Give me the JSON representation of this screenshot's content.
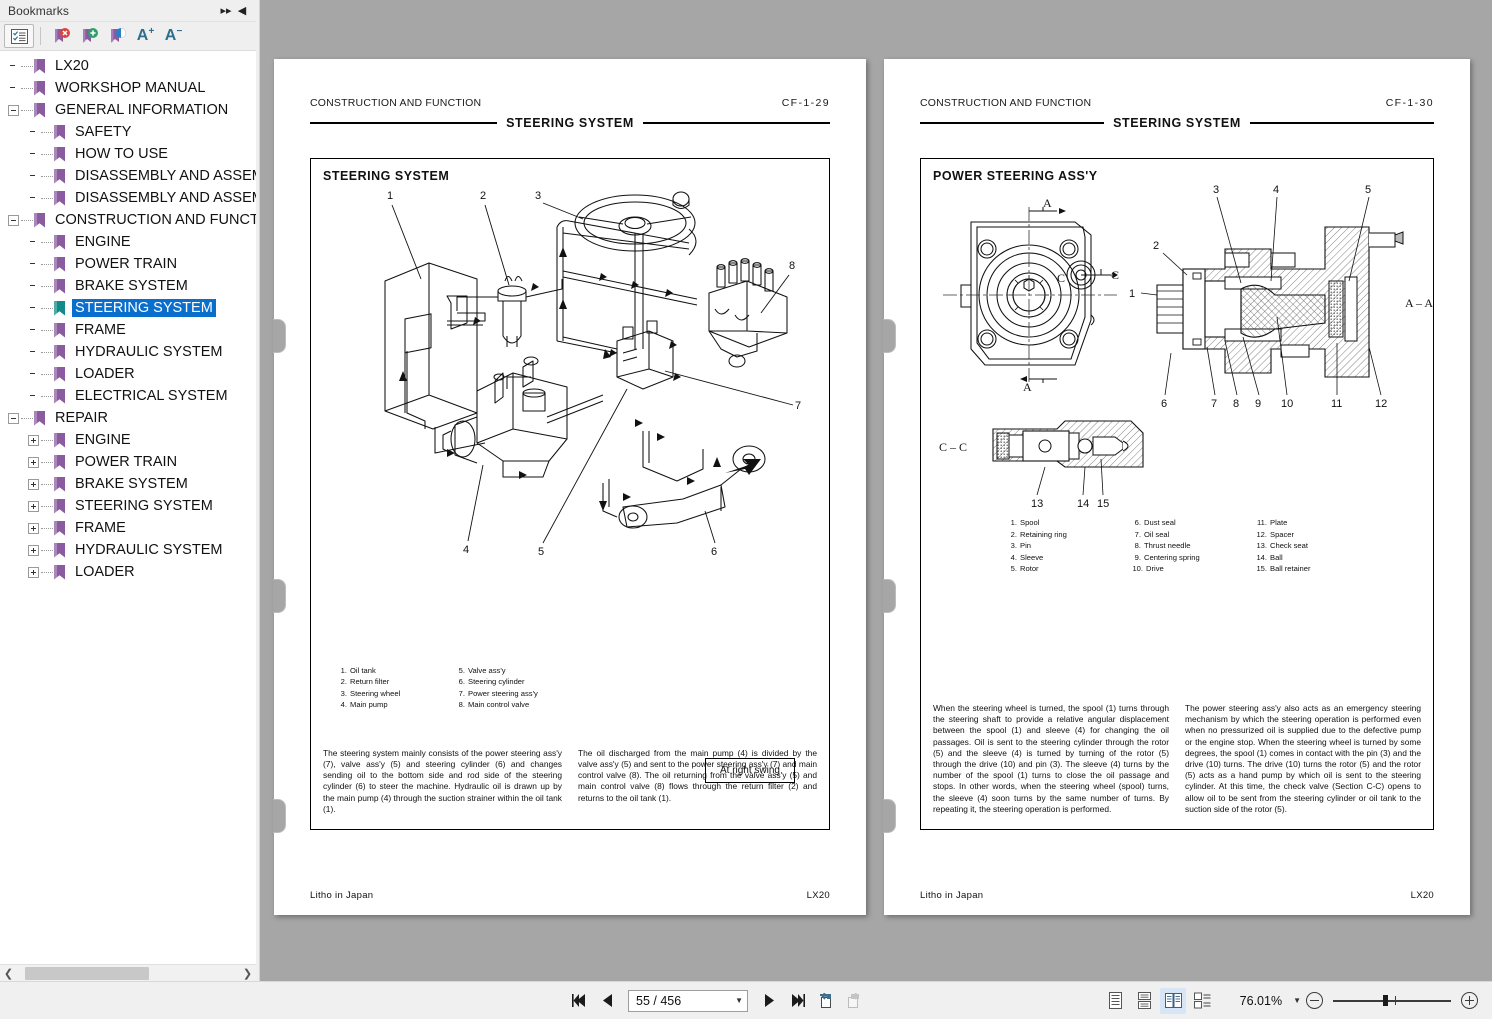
{
  "bookmarks_panel": {
    "title": "Bookmarks",
    "collapse_all_icon": "chevron-double-right-icon",
    "hide_panel_icon": "triangle-left-icon",
    "toolbar": [
      {
        "name": "bookmark-options-icon",
        "glyph": "list-check"
      },
      {
        "name": "delete-bookmark-icon",
        "glyph": "bookmark-x"
      },
      {
        "name": "new-bookmark-icon",
        "glyph": "bookmark-plus"
      },
      {
        "name": "bookmark-properties-icon",
        "glyph": "bookmark-info"
      },
      {
        "name": "expand-text-icon",
        "label": "A",
        "sup": "+"
      },
      {
        "name": "shrink-text-icon",
        "label": "A",
        "sup": "−"
      }
    ],
    "items": [
      {
        "label": "LX20",
        "level": 0,
        "expander": "none",
        "selected": false
      },
      {
        "label": "WORKSHOP MANUAL",
        "level": 0,
        "expander": "none",
        "selected": false
      },
      {
        "label": "GENERAL INFORMATION",
        "level": 0,
        "expander": "minus",
        "selected": false
      },
      {
        "label": "SAFETY",
        "level": 1,
        "expander": "none",
        "selected": false
      },
      {
        "label": "HOW TO USE",
        "level": 1,
        "expander": "none",
        "selected": false
      },
      {
        "label": "DISASSEMBLY AND ASSEMB",
        "level": 1,
        "expander": "none",
        "selected": false
      },
      {
        "label": "DISASSEMBLY AND ASSEMB",
        "level": 1,
        "expander": "none",
        "selected": false
      },
      {
        "label": "CONSTRUCTION AND FUNCTI",
        "level": 0,
        "expander": "minus",
        "selected": false
      },
      {
        "label": "ENGINE",
        "level": 1,
        "expander": "none",
        "selected": false
      },
      {
        "label": "POWER TRAIN",
        "level": 1,
        "expander": "none",
        "selected": false
      },
      {
        "label": "BRAKE SYSTEM",
        "level": 1,
        "expander": "none",
        "selected": false
      },
      {
        "label": "STEERING SYSTEM",
        "level": 1,
        "expander": "none",
        "selected": true
      },
      {
        "label": "FRAME",
        "level": 1,
        "expander": "none",
        "selected": false
      },
      {
        "label": "HYDRAULIC SYSTEM",
        "level": 1,
        "expander": "none",
        "selected": false
      },
      {
        "label": "LOADER",
        "level": 1,
        "expander": "none",
        "selected": false
      },
      {
        "label": "ELECTRICAL SYSTEM",
        "level": 1,
        "expander": "none",
        "selected": false
      },
      {
        "label": "REPAIR",
        "level": 0,
        "expander": "minus",
        "selected": false
      },
      {
        "label": "ENGINE",
        "level": 1,
        "expander": "plus",
        "selected": false
      },
      {
        "label": "POWER TRAIN",
        "level": 1,
        "expander": "plus",
        "selected": false
      },
      {
        "label": "BRAKE SYSTEM",
        "level": 1,
        "expander": "plus",
        "selected": false
      },
      {
        "label": "STEERING SYSTEM",
        "level": 1,
        "expander": "plus",
        "selected": false
      },
      {
        "label": "FRAME",
        "level": 1,
        "expander": "plus",
        "selected": false
      },
      {
        "label": "HYDRAULIC SYSTEM",
        "level": 1,
        "expander": "plus",
        "selected": false
      },
      {
        "label": "LOADER",
        "level": 1,
        "expander": "plus",
        "selected": false
      }
    ],
    "selection_color": "#0a6ecd",
    "bookmark_icon_color": "#8b5ba0",
    "selected_bookmark_icon_color": "#138a8a"
  },
  "left_page": {
    "header_left": "CONSTRUCTION AND FUNCTION",
    "header_right": "CF-1-29",
    "rule_title": "STEERING SYSTEM",
    "panel_title": "STEERING  SYSTEM",
    "callout_box": "At right swing",
    "legend_left": [
      {
        "num": "1.",
        "label": "Oil tank"
      },
      {
        "num": "2.",
        "label": "Return filter"
      },
      {
        "num": "3.",
        "label": "Steering wheel"
      },
      {
        "num": "4.",
        "label": "Main pump"
      }
    ],
    "legend_right": [
      {
        "num": "5.",
        "label": "Valve ass'y"
      },
      {
        "num": "6.",
        "label": "Steering cylinder"
      },
      {
        "num": "7.",
        "label": "Power steering ass'y"
      },
      {
        "num": "8.",
        "label": "Main control valve"
      }
    ],
    "body_col1": "The steering system mainly consists of the power steering ass'y (7), valve ass'y (5) and steering cylinder (6) and changes sending oil to the bottom side and rod side of the steering cylinder (6) to steer the machine.  Hydraulic oil is drawn up by the main pump (4) through the suction strainer within the oil tank (1).",
    "body_col2": "The oil discharged from the main pump (4) is divided by the valve ass'y (5) and sent to the power steering ass'y (7) and main control valve (8).  The oil returning from the valve ass'y (5) and main control valve (8) flows through the return filter (2) and returns to the oil tank (1).",
    "footer_left": "Litho  in  Japan",
    "footer_right": "LX20",
    "figure_callouts": [
      "1",
      "2",
      "3",
      "4",
      "5",
      "6",
      "7",
      "8"
    ]
  },
  "right_page": {
    "header_left": "CONSTRUCTION AND FUNCTION",
    "header_right": "CF-1-30",
    "rule_title": "STEERING SYSTEM",
    "panel_title": "POWER STEERING ASS'Y",
    "section_labels": [
      "A",
      "A",
      "C",
      "C",
      "A – A",
      "C – C"
    ],
    "legend_col1": [
      {
        "num": "1.",
        "label": "Spool"
      },
      {
        "num": "2.",
        "label": "Retaining ring"
      },
      {
        "num": "3.",
        "label": "Pin"
      },
      {
        "num": "4.",
        "label": "Sleeve"
      },
      {
        "num": "5.",
        "label": "Rotor"
      }
    ],
    "legend_col2": [
      {
        "num": "6.",
        "label": "Dust seal"
      },
      {
        "num": "7.",
        "label": "Oil seal"
      },
      {
        "num": "8.",
        "label": "Thrust needle"
      },
      {
        "num": "9.",
        "label": "Centering spring"
      },
      {
        "num": "10.",
        "label": "Drive"
      }
    ],
    "legend_col3": [
      {
        "num": "11.",
        "label": "Plate"
      },
      {
        "num": "12.",
        "label": "Spacer"
      },
      {
        "num": "13.",
        "label": "Check seat"
      },
      {
        "num": "14.",
        "label": "Ball"
      },
      {
        "num": "15.",
        "label": "Ball retainer"
      }
    ],
    "body_col1": "When the steering wheel is turned, the spool (1) turns through the steering shaft to provide a relative angular displacement between the spool (1) and sleeve (4) for changing the oil passages. Oil is sent to the steering cylinder through the rotor (5) and the sleeve (4) is turned by turning of the rotor (5) through the drive (10) and pin (3).  The sleeve (4) turns by the number of the spool (1) turns to close the oil passage and stops.  In other words, when the steering wheel (spool) turns, the sleeve (4) soon turns by the same number of turns.  By repeating it, the steering operation is performed.",
    "body_col2": "The power steering ass'y also acts as an emergency steering mechanism by which the steering operation is performed even when no pressurized oil is supplied due to the defective pump or the engine stop.  When the steering wheel is turned by some degrees, the spool (1) comes in contact with the pin (3) and the drive (10) turns.  The drive (10) turns the rotor (5) and the rotor (5) acts as a hand pump by which oil is sent to the steering cylinder. At this time, the check valve (Section C-C) opens to allow oil to be sent from the steering cylinder or oil tank to the suction side of the rotor (5).",
    "footer_left": "Litho  in  Japan",
    "footer_right": "LX20",
    "figure_callouts": [
      "1",
      "2",
      "3",
      "4",
      "5",
      "6",
      "7",
      "8",
      "9",
      "10",
      "11",
      "12",
      "13",
      "14",
      "15"
    ]
  },
  "bottom_toolbar": {
    "first_page_icon": "first-page-icon",
    "prev_page_icon": "previous-page-icon",
    "page_value": "55 / 456",
    "page_dropdown_icon": "chevron-down-icon",
    "next_page_icon": "next-page-icon",
    "last_page_icon": "last-page-icon",
    "prev_view_icon": "previous-view-icon",
    "next_view_icon": "next-view-icon",
    "view_single_icon": "single-page-view-icon",
    "view_continuous_icon": "continuous-scroll-icon",
    "view_two_page_icon": "two-page-view-icon",
    "view_two_page_scroll_icon": "two-page-scroll-icon",
    "zoom_value": "76.01%",
    "zoom_dropdown_icon": "chevron-down-icon",
    "zoom_out_icon": "zoom-out-icon",
    "zoom_in_icon": "zoom-in-icon"
  }
}
